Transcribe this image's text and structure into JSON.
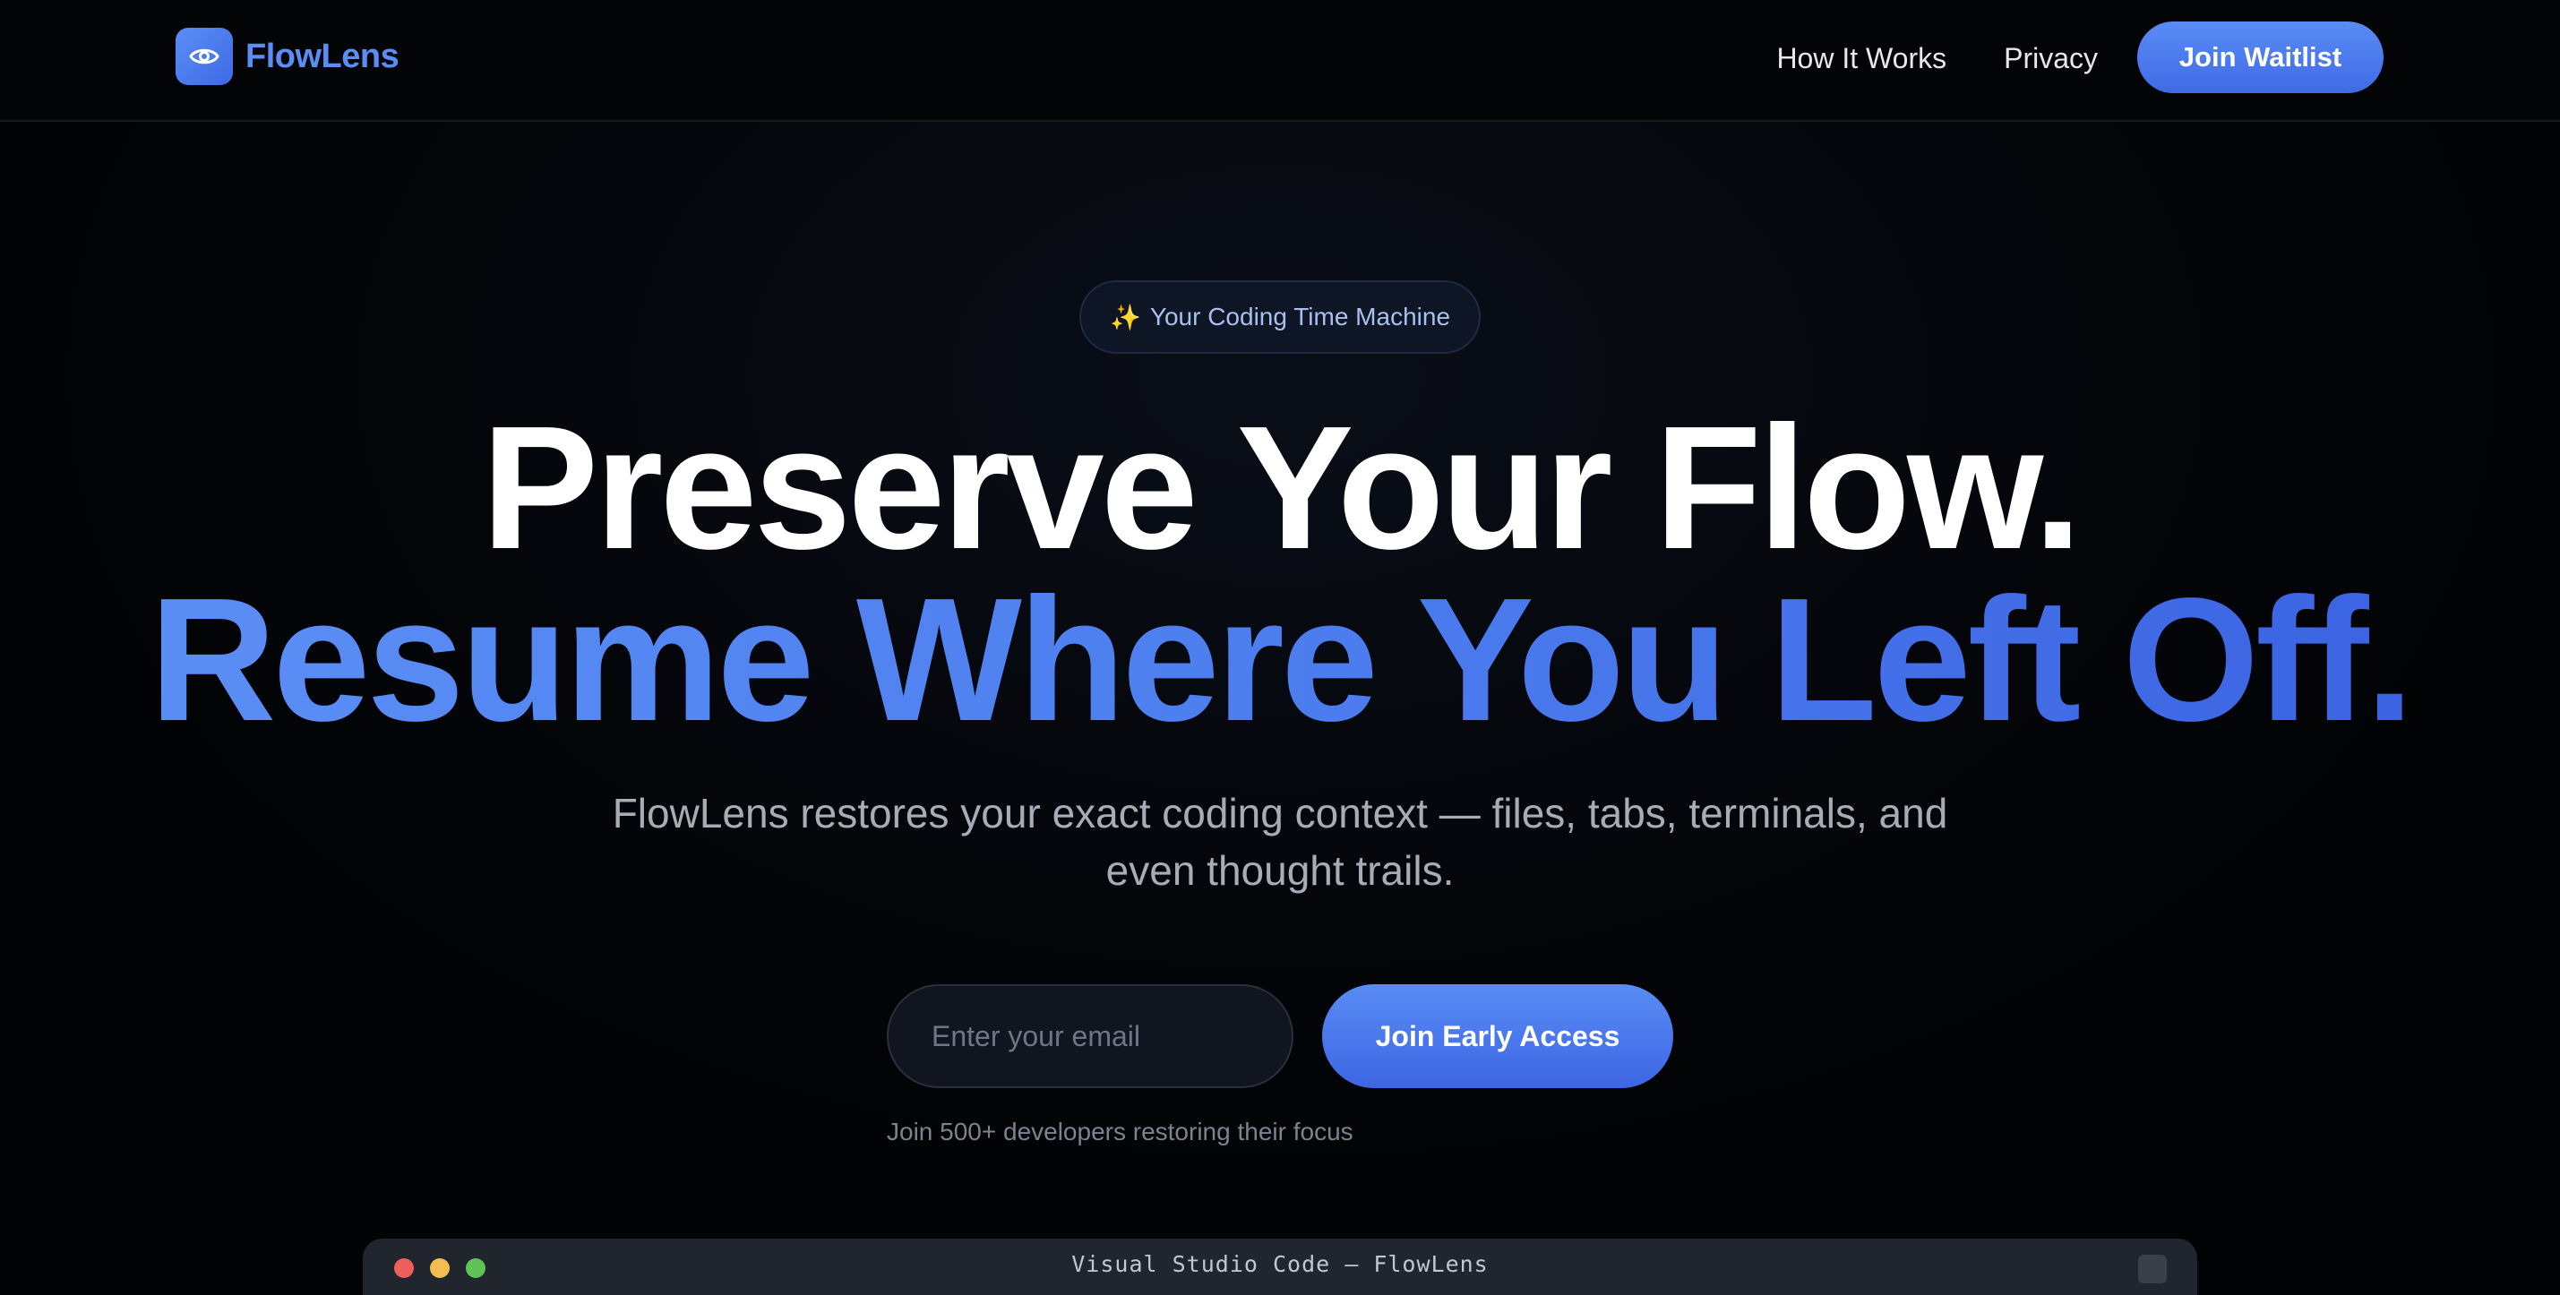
{
  "brand": {
    "name": "FlowLens",
    "icon": "eye-icon",
    "accent_color": "#5b8ef5"
  },
  "nav": {
    "links": [
      {
        "label": "How It Works"
      },
      {
        "label": "Privacy"
      }
    ],
    "cta_label": "Join Waitlist"
  },
  "hero": {
    "badge_icon": "sparkles-icon",
    "badge_emoji": "✨",
    "badge_text": "Your Coding Time Machine",
    "headline_line1": "Preserve Your Flow.",
    "headline_line2": "Resume Where You Left Off.",
    "subtitle": "FlowLens restores your exact coding context — files, tabs, terminals, and even thought trails."
  },
  "signup": {
    "email_placeholder": "Enter your email",
    "cta_label": "Join Early Access",
    "note": "Join 500+ developers restoring their focus"
  },
  "editor_preview": {
    "window_title": "Visual Studio Code — FlowLens",
    "traffic_light_colors": [
      "#ec5f5a",
      "#f3bd4f",
      "#5fc455"
    ]
  }
}
